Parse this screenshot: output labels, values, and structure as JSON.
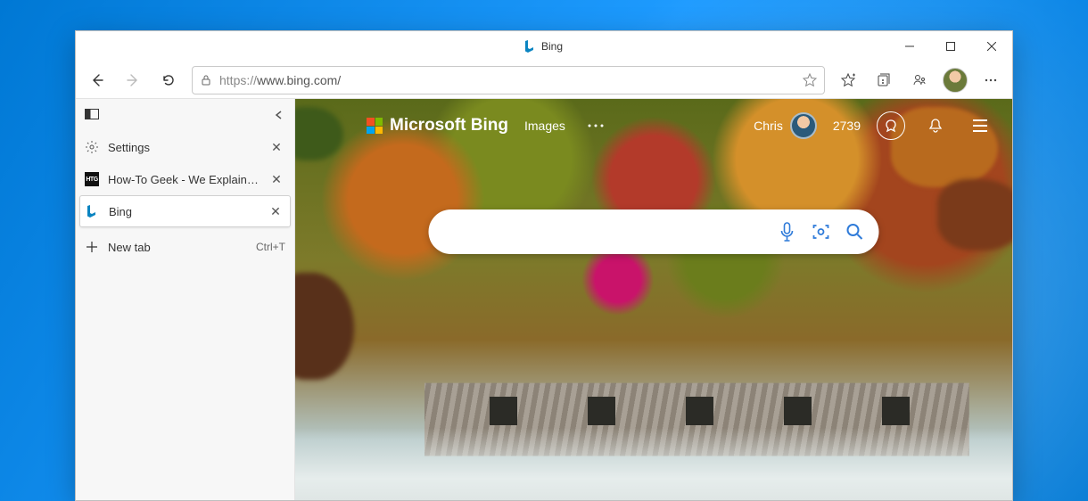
{
  "window": {
    "title": "Bing"
  },
  "toolbar": {
    "url_scheme": "https://",
    "url_rest": "www.bing.com/"
  },
  "sidebar": {
    "tabs": [
      {
        "icon": "gear",
        "label": "Settings"
      },
      {
        "icon": "htg",
        "label": "How-To Geek - We Explain Techn"
      },
      {
        "icon": "bing",
        "label": "Bing",
        "active": true
      }
    ],
    "newtab_label": "New tab",
    "newtab_shortcut": "Ctrl+T"
  },
  "bing": {
    "brand": "Microsoft Bing",
    "nav_images": "Images",
    "user_name": "Chris",
    "points": "2739",
    "search_placeholder": ""
  }
}
